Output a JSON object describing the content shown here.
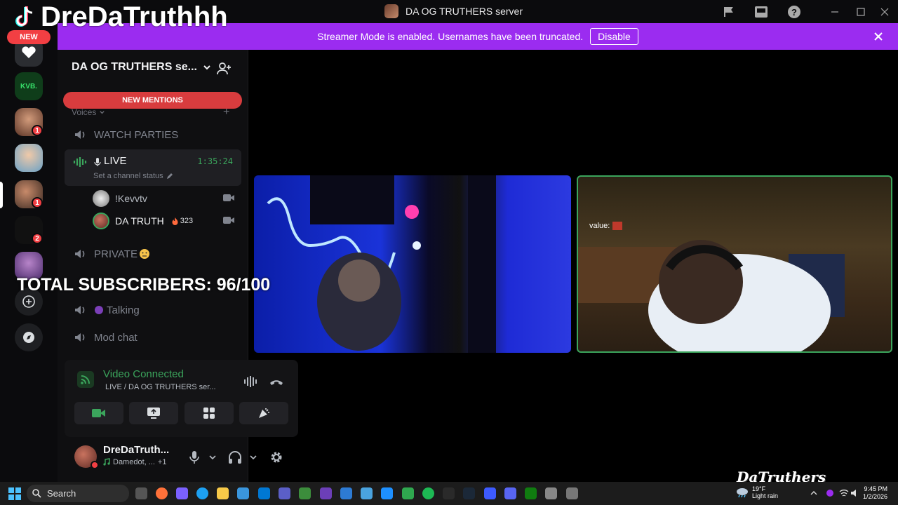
{
  "overlay": {
    "brand_name": "DreDaTruthhh",
    "new_label": "NEW",
    "subscribers": "TOTAL SUBSCRIBERS: 96/100",
    "watermark": "DaTruthers"
  },
  "titlebar": {
    "server_title": "DA OG TRUTHERS server"
  },
  "banner": {
    "text": "Streamer Mode is enabled. Usernames have been truncated.",
    "disable_label": "Disable"
  },
  "rail": {
    "badges": [
      "1",
      "1",
      "2"
    ],
    "kvb_label": "KVB."
  },
  "sidebar": {
    "server_name": "DA OG TRUTHERS se...",
    "new_mentions": "NEW MENTIONS",
    "category": "Voices",
    "channels": [
      {
        "label": "WATCH PARTIES"
      },
      {
        "label": "LIVE",
        "timer": "1:35:24",
        "status": "Set a channel status"
      },
      {
        "label": "PRIVATE"
      },
      {
        "label": "Talking"
      },
      {
        "label": "Mod chat"
      }
    ],
    "voice_users": [
      {
        "name": "!Kevvtv"
      },
      {
        "name": "DA TRUTH",
        "count": "323"
      }
    ]
  },
  "voice_panel": {
    "title": "Video Connected",
    "subtitle": "LIVE / DA OG TRUTHERS ser..."
  },
  "user_panel": {
    "name": "DreDaTruth...",
    "status": "Damedot, ...",
    "extra": "+1"
  },
  "stage": {
    "value_tag": "value:"
  },
  "taskbar": {
    "search": "Search",
    "weather_temp": "19°F",
    "weather_desc": "Light rain",
    "time": "9:45 PM",
    "date": "1/2/2026"
  },
  "colors": {
    "accent_purple": "#9b2cf0",
    "mention_red": "#d83c3e",
    "connected_green": "#3ba55c"
  }
}
